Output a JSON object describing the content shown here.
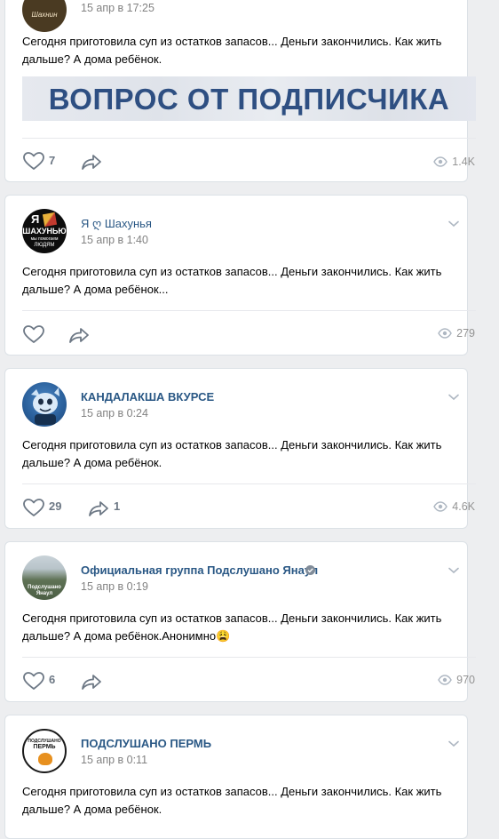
{
  "posts": [
    {
      "author": "",
      "avatar_text": "Шахнин",
      "date": "15 апр в 17:25",
      "text": "Сегодня приготовила суп из остатков запасов... Деньги закончились. Как жить дальше? А дома ребёнок.",
      "banner": "ВОПРОС ОТ ПОДПИСЧИКА",
      "likes": "7",
      "shares": "",
      "views": "1.4K"
    },
    {
      "author": "Я ღ Шахунья",
      "avatar_text": [
        "Я",
        "ШАХУНЬЮ",
        "мы помогаем",
        "ЛЮДЯМ"
      ],
      "date": "15 апр в 1:40",
      "text": "Сегодня приготовила суп из остатков запасов... Деньги закончились. Как жить дальше? А дома ребёнок...",
      "likes": "",
      "shares": "",
      "views": "279"
    },
    {
      "author": "КАНДАЛАКША ВКУРСЕ",
      "date": "15 апр в 0:24",
      "text": "Сегодня приготовила суп из остатков запасов... Деньги закончились. Как жить дальше? А дома ребёнок.",
      "likes": "29",
      "shares": "1",
      "views": "4.6K"
    },
    {
      "author": "Официальная группа Подслушано Янаул",
      "avatar_text": [
        "Подслушано",
        "Янаул"
      ],
      "date": "15 апр в 0:19",
      "text": "Сегодня приготовила суп из остатков запасов... Деньги закончились. Как жить дальше? А дома ребёнок.Анонимно😩",
      "likes": "6",
      "shares": "",
      "views": "970"
    },
    {
      "author": "ПОДСЛУШАНО ПЕРМЬ",
      "avatar_text": [
        "ПОДСЛУШАНО",
        "ПЕРМЬ"
      ],
      "date": "15 апр в 0:11",
      "text": "Сегодня приготовила суп из остатков запасов... Деньги закончились. Как жить дальше? А дома ребёнок."
    }
  ],
  "colors": {
    "background": "#edeef0",
    "author_link": "#2a5885",
    "meta": "#828282",
    "action": "#6d7885",
    "banner_text": "#2e4f82",
    "verified": "#818c99"
  },
  "icons": {
    "like": "heart-icon",
    "share": "share-arrow-icon",
    "views": "eye-icon",
    "menu": "chevron-down-icon",
    "verified": "verified-icon"
  }
}
